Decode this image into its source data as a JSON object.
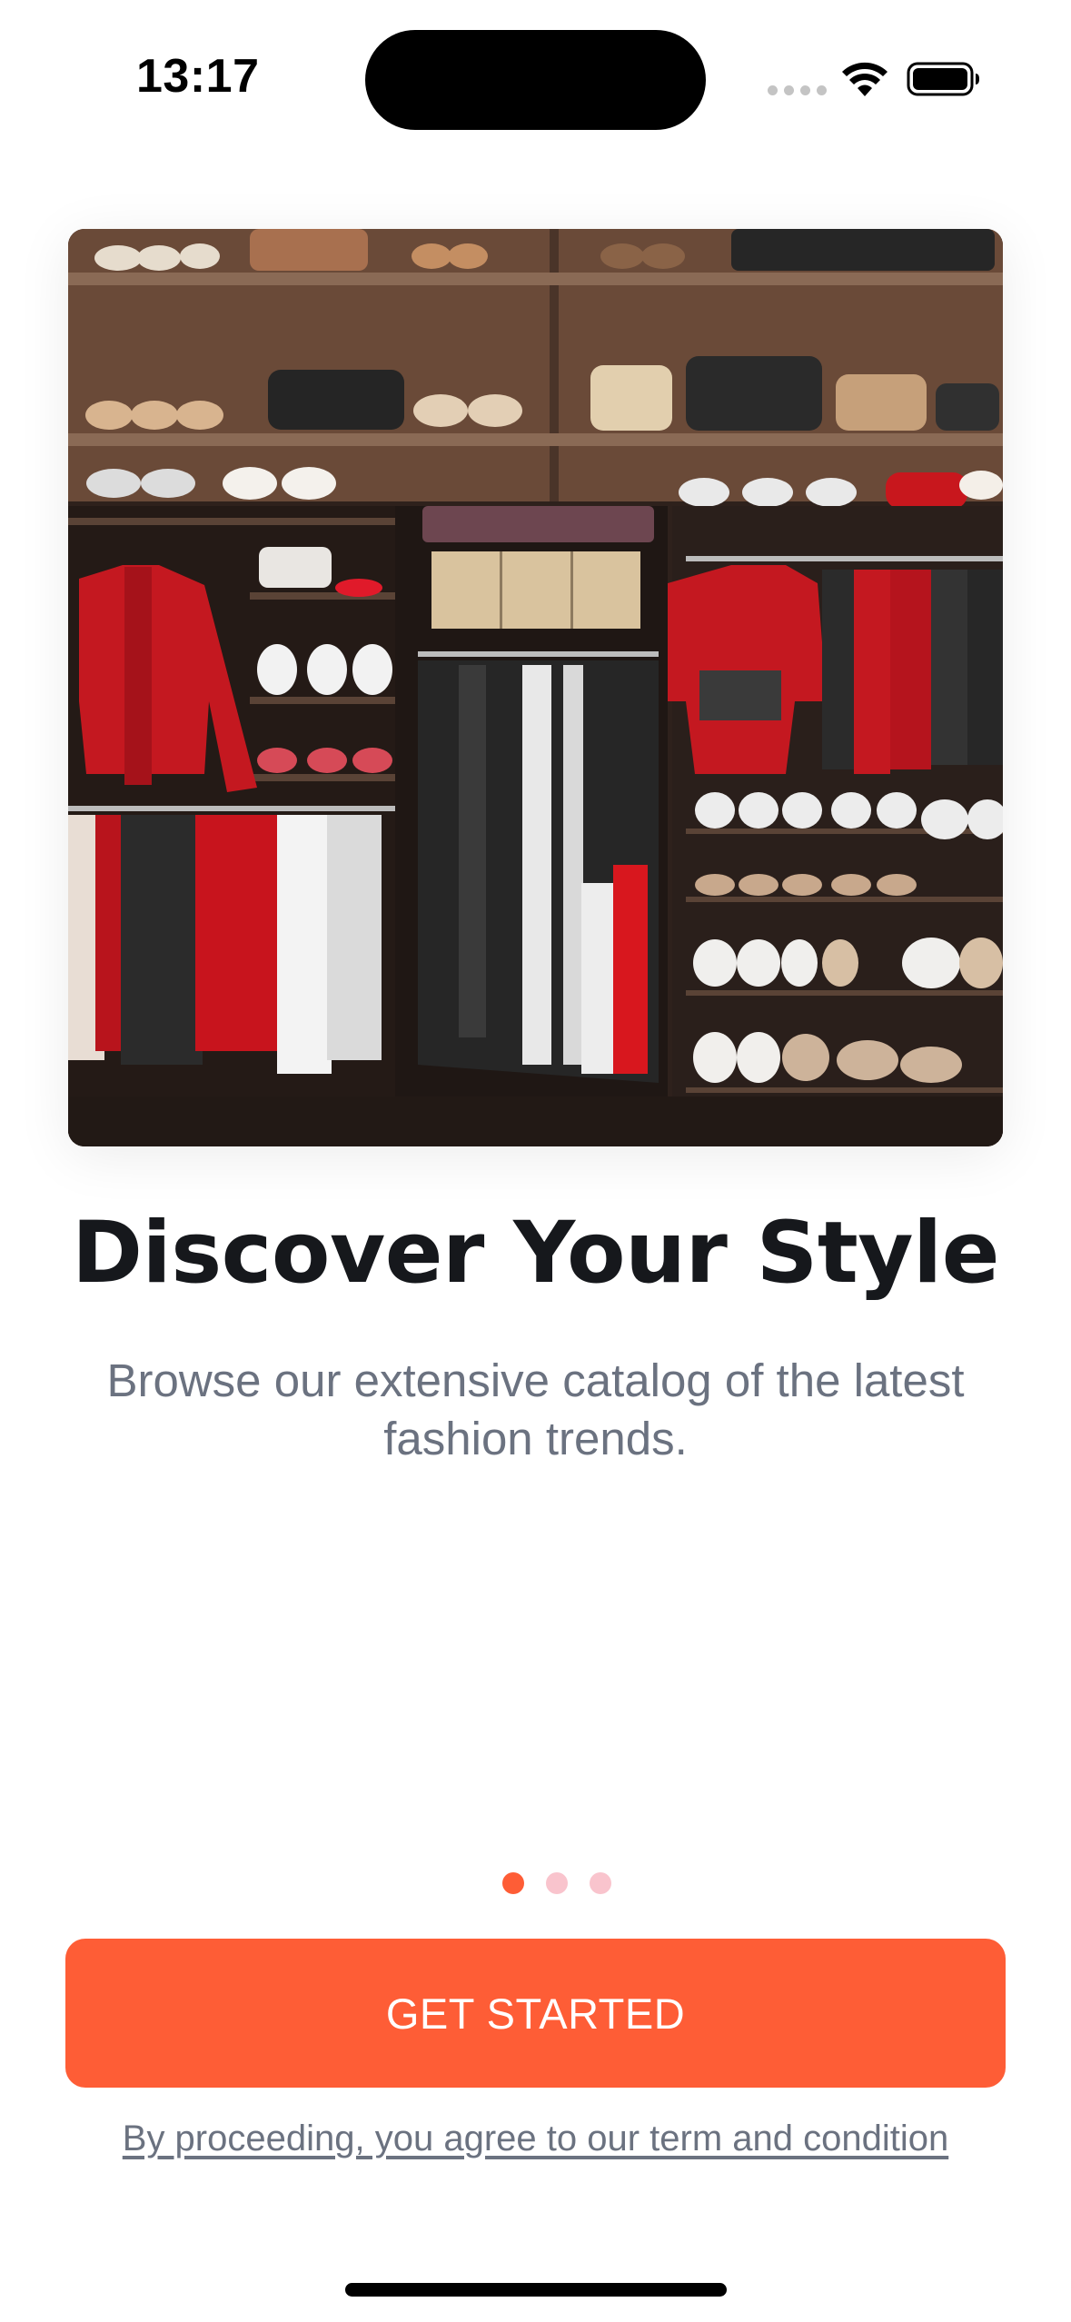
{
  "status_bar": {
    "time": "13:17"
  },
  "hero": {
    "image_alt": "Clothing store wall with shelves of shoes, bags and racks of red, black and white garments",
    "icon": "photo"
  },
  "onboarding": {
    "title": "Discover Your Style",
    "subtitle": "Browse our extensive catalog of the latest fashion trends.",
    "page_indicator": {
      "total": 3,
      "current": 1
    },
    "cta_label": "GET STARTED",
    "terms_text": "By proceeding, you agree to our term and condition"
  },
  "colors": {
    "accent": "#fe5d36",
    "dot_inactive": "#f9c4cd",
    "title": "#16181c",
    "subtitle": "#6b7280"
  }
}
